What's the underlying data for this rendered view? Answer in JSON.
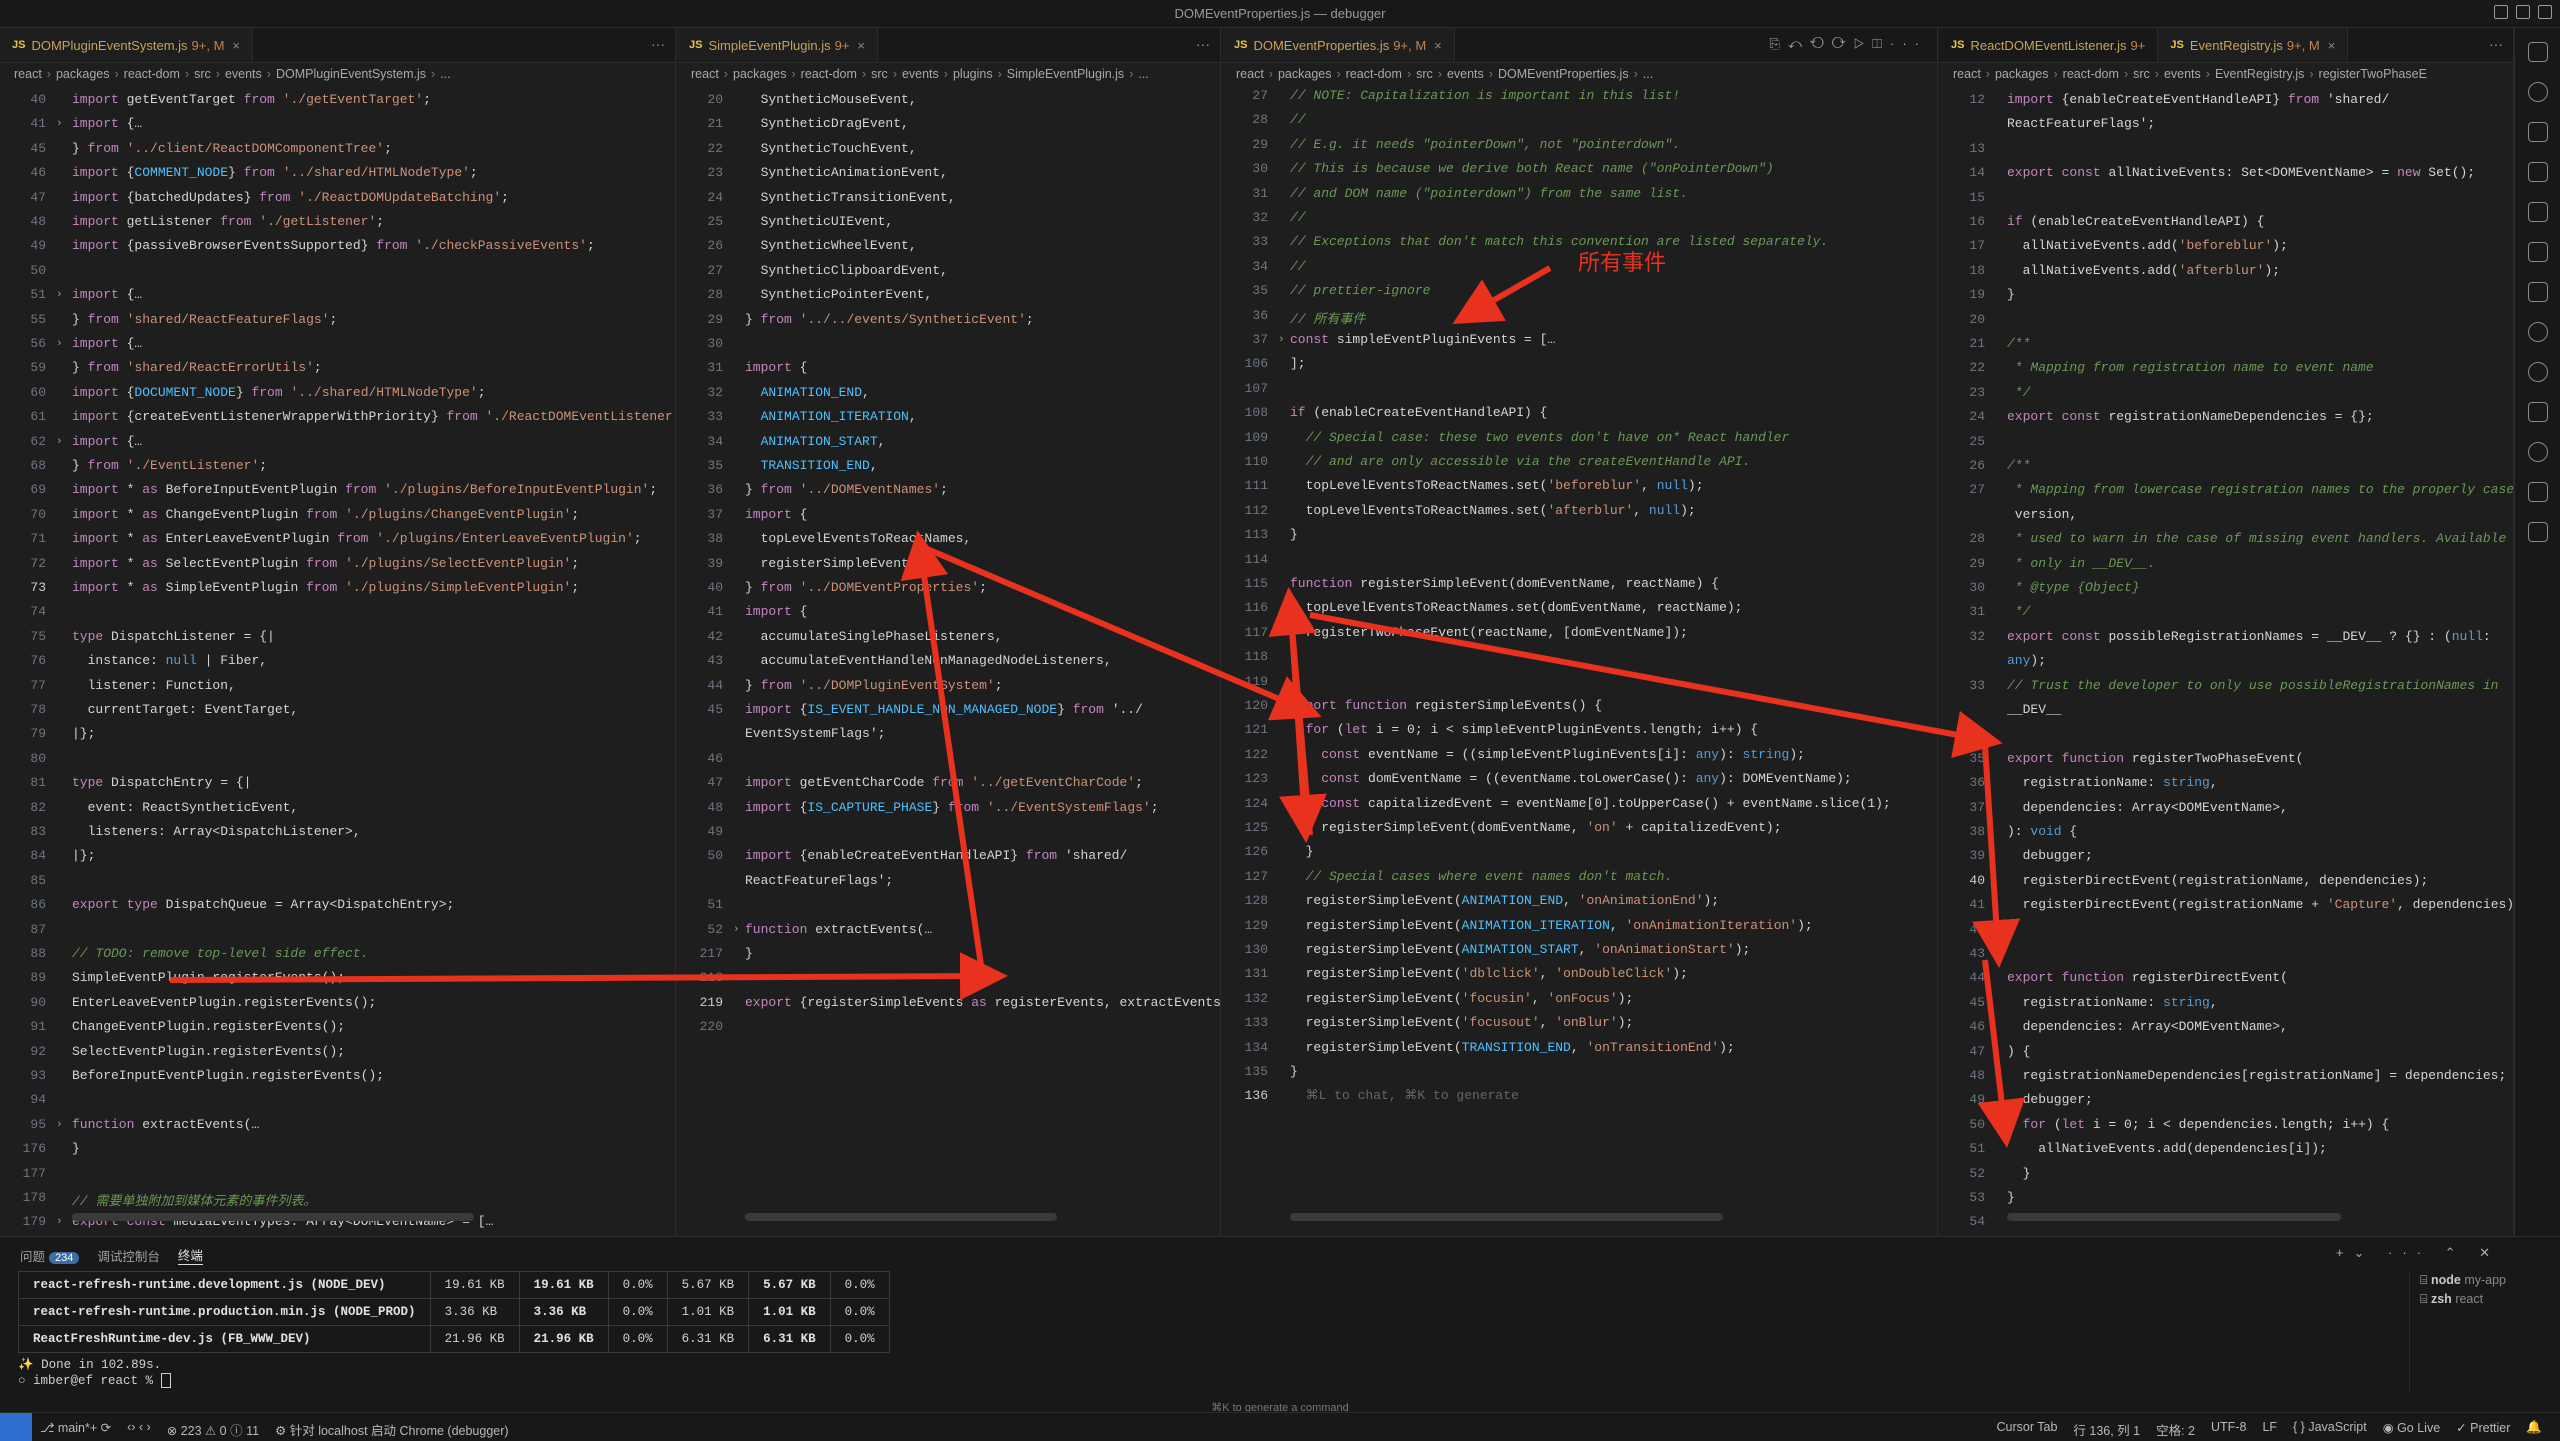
{
  "window": {
    "title": "DOMEventProperties.js — debugger"
  },
  "panes": [
    {
      "tab": {
        "name": "DOMPluginEventSystem.js",
        "modified": "9+, M"
      },
      "breadcrumb": [
        "react",
        "packages",
        "react-dom",
        "src",
        "events",
        "DOMPluginEventSystem.js",
        "..."
      ],
      "lines": [
        {
          "n": "40",
          "t": "import getEventTarget from './getEventTarget';"
        },
        {
          "n": "41",
          "t": "import {…",
          "fold": true
        },
        {
          "n": "45",
          "t": "} from '../client/ReactDOMComponentTree';"
        },
        {
          "n": "46",
          "t": "import {COMMENT_NODE} from '../shared/HTMLNodeType';"
        },
        {
          "n": "47",
          "t": "import {batchedUpdates} from './ReactDOMUpdateBatching';"
        },
        {
          "n": "48",
          "t": "import getListener from './getListener';"
        },
        {
          "n": "49",
          "t": "import {passiveBrowserEventsSupported} from './checkPassiveEvents';"
        },
        {
          "n": "50",
          "t": ""
        },
        {
          "n": "51",
          "t": "import {…",
          "fold": true
        },
        {
          "n": "55",
          "t": "} from 'shared/ReactFeatureFlags';"
        },
        {
          "n": "56",
          "t": "import {…",
          "fold": true
        },
        {
          "n": "59",
          "t": "} from 'shared/ReactErrorUtils';"
        },
        {
          "n": "60",
          "t": "import {DOCUMENT_NODE} from '../shared/HTMLNodeType';"
        },
        {
          "n": "61",
          "t": "import {createEventListenerWrapperWithPriority} from './ReactDOMEventListener';"
        },
        {
          "n": "62",
          "t": "import {…",
          "fold": true
        },
        {
          "n": "68",
          "t": "} from './EventListener';"
        },
        {
          "n": "69",
          "t": "import * as BeforeInputEventPlugin from './plugins/BeforeInputEventPlugin';"
        },
        {
          "n": "70",
          "t": "import * as ChangeEventPlugin from './plugins/ChangeEventPlugin';"
        },
        {
          "n": "71",
          "t": "import * as EnterLeaveEventPlugin from './plugins/EnterLeaveEventPlugin';"
        },
        {
          "n": "72",
          "t": "import * as SelectEventPlugin from './plugins/SelectEventPlugin';"
        },
        {
          "n": "73",
          "t": "import * as SimpleEventPlugin from './plugins/SimpleEventPlugin';",
          "cur": true
        },
        {
          "n": "74",
          "t": ""
        },
        {
          "n": "75",
          "t": "type DispatchListener = {|"
        },
        {
          "n": "76",
          "t": "  instance: null | Fiber,"
        },
        {
          "n": "77",
          "t": "  listener: Function,"
        },
        {
          "n": "78",
          "t": "  currentTarget: EventTarget,"
        },
        {
          "n": "79",
          "t": "|};"
        },
        {
          "n": "80",
          "t": ""
        },
        {
          "n": "81",
          "t": "type DispatchEntry = {|"
        },
        {
          "n": "82",
          "t": "  event: ReactSyntheticEvent,"
        },
        {
          "n": "83",
          "t": "  listeners: Array<DispatchListener>,"
        },
        {
          "n": "84",
          "t": "|};"
        },
        {
          "n": "85",
          "t": ""
        },
        {
          "n": "86",
          "t": "export type DispatchQueue = Array<DispatchEntry>;"
        },
        {
          "n": "87",
          "t": ""
        },
        {
          "n": "88",
          "t": "// TODO: remove top-level side effect."
        },
        {
          "n": "89",
          "t": "SimpleEventPlugin.registerEvents();"
        },
        {
          "n": "90",
          "t": "EnterLeaveEventPlugin.registerEvents();"
        },
        {
          "n": "91",
          "t": "ChangeEventPlugin.registerEvents();"
        },
        {
          "n": "92",
          "t": "SelectEventPlugin.registerEvents();"
        },
        {
          "n": "93",
          "t": "BeforeInputEventPlugin.registerEvents();"
        },
        {
          "n": "94",
          "t": ""
        },
        {
          "n": "95",
          "t": "function extractEvents(…",
          "fold": true
        },
        {
          "n": "176",
          "t": "}"
        },
        {
          "n": "177",
          "t": ""
        },
        {
          "n": "178",
          "t": "// 需要单独附加到媒体元素的事件列表。"
        },
        {
          "n": "179",
          "t": "export const mediaEventTypes: Array<DOMEventName> = […",
          "fold": true
        }
      ]
    },
    {
      "tab": {
        "name": "SimpleEventPlugin.js",
        "modified": "9+"
      },
      "breadcrumb": [
        "react",
        "packages",
        "react-dom",
        "src",
        "events",
        "plugins",
        "SimpleEventPlugin.js",
        "..."
      ],
      "lines": [
        {
          "n": "20",
          "t": "  SyntheticMouseEvent,"
        },
        {
          "n": "21",
          "t": "  SyntheticDragEvent,"
        },
        {
          "n": "22",
          "t": "  SyntheticTouchEvent,"
        },
        {
          "n": "23",
          "t": "  SyntheticAnimationEvent,"
        },
        {
          "n": "24",
          "t": "  SyntheticTransitionEvent,"
        },
        {
          "n": "25",
          "t": "  SyntheticUIEvent,"
        },
        {
          "n": "26",
          "t": "  SyntheticWheelEvent,"
        },
        {
          "n": "27",
          "t": "  SyntheticClipboardEvent,"
        },
        {
          "n": "28",
          "t": "  SyntheticPointerEvent,"
        },
        {
          "n": "29",
          "t": "} from '../../events/SyntheticEvent';"
        },
        {
          "n": "30",
          "t": ""
        },
        {
          "n": "31",
          "t": "import {"
        },
        {
          "n": "32",
          "t": "  ANIMATION_END,"
        },
        {
          "n": "33",
          "t": "  ANIMATION_ITERATION,"
        },
        {
          "n": "34",
          "t": "  ANIMATION_START,"
        },
        {
          "n": "35",
          "t": "  TRANSITION_END,"
        },
        {
          "n": "36",
          "t": "} from '../DOMEventNames';"
        },
        {
          "n": "37",
          "t": "import {"
        },
        {
          "n": "38",
          "t": "  topLevelEventsToReactNames,"
        },
        {
          "n": "39",
          "t": "  registerSimpleEvents,"
        },
        {
          "n": "40",
          "t": "} from '../DOMEventProperties';"
        },
        {
          "n": "41",
          "t": "import {"
        },
        {
          "n": "42",
          "t": "  accumulateSinglePhaseListeners,"
        },
        {
          "n": "43",
          "t": "  accumulateEventHandleNonManagedNodeListeners,"
        },
        {
          "n": "44",
          "t": "} from '../DOMPluginEventSystem';"
        },
        {
          "n": "45",
          "t": "import {IS_EVENT_HANDLE_NON_MANAGED_NODE} from '../"
        },
        {
          "n": "",
          "t": "EventSystemFlags';"
        },
        {
          "n": "46",
          "t": ""
        },
        {
          "n": "47",
          "t": "import getEventCharCode from '../getEventCharCode';"
        },
        {
          "n": "48",
          "t": "import {IS_CAPTURE_PHASE} from '../EventSystemFlags';"
        },
        {
          "n": "49",
          "t": ""
        },
        {
          "n": "50",
          "t": "import {enableCreateEventHandleAPI} from 'shared/"
        },
        {
          "n": "",
          "t": "ReactFeatureFlags';"
        },
        {
          "n": "51",
          "t": ""
        },
        {
          "n": "52",
          "t": "function extractEvents(…",
          "fold": true
        },
        {
          "n": "217",
          "t": "}"
        },
        {
          "n": "218",
          "t": ""
        },
        {
          "n": "219",
          "t": "export {registerSimpleEvents as registerEvents, extractEvents};",
          "cur": true
        },
        {
          "n": "220",
          "t": ""
        }
      ]
    },
    {
      "tab": {
        "name": "DOMEventProperties.js",
        "modified": "9+, M"
      },
      "breadcrumb": [
        "react",
        "packages",
        "react-dom",
        "src",
        "events",
        "DOMEventProperties.js",
        "..."
      ],
      "lines": [
        {
          "n": "27",
          "t": "// NOTE: Capitalization is important in this list!"
        },
        {
          "n": "28",
          "t": "//"
        },
        {
          "n": "29",
          "t": "// E.g. it needs \"pointerDown\", not \"pointerdown\"."
        },
        {
          "n": "30",
          "t": "// This is because we derive both React name (\"onPointerDown\")"
        },
        {
          "n": "31",
          "t": "// and DOM name (\"pointerdown\") from the same list."
        },
        {
          "n": "32",
          "t": "//"
        },
        {
          "n": "33",
          "t": "// Exceptions that don't match this convention are listed separately."
        },
        {
          "n": "34",
          "t": "//"
        },
        {
          "n": "35",
          "t": "// prettier-ignore"
        },
        {
          "n": "36",
          "t": "// 所有事件"
        },
        {
          "n": "37",
          "t": "const simpleEventPluginEvents = […",
          "fold": true
        },
        {
          "n": "106",
          "t": "];"
        },
        {
          "n": "107",
          "t": ""
        },
        {
          "n": "108",
          "t": "if (enableCreateEventHandleAPI) {"
        },
        {
          "n": "109",
          "t": "  // Special case: these two events don't have on* React handler"
        },
        {
          "n": "110",
          "t": "  // and are only accessible via the createEventHandle API."
        },
        {
          "n": "111",
          "t": "  topLevelEventsToReactNames.set('beforeblur', null);"
        },
        {
          "n": "112",
          "t": "  topLevelEventsToReactNames.set('afterblur', null);"
        },
        {
          "n": "113",
          "t": "}"
        },
        {
          "n": "114",
          "t": ""
        },
        {
          "n": "115",
          "t": "function registerSimpleEvent(domEventName, reactName) {"
        },
        {
          "n": "116",
          "t": "  topLevelEventsToReactNames.set(domEventName, reactName);"
        },
        {
          "n": "117",
          "t": "  registerTwoPhaseEvent(reactName, [domEventName]);"
        },
        {
          "n": "118",
          "t": "}"
        },
        {
          "n": "119",
          "t": ""
        },
        {
          "n": "120",
          "t": "export function registerSimpleEvents() {"
        },
        {
          "n": "121",
          "t": "  for (let i = 0; i < simpleEventPluginEvents.length; i++) {"
        },
        {
          "n": "122",
          "t": "    const eventName = ((simpleEventPluginEvents[i]: any): string);"
        },
        {
          "n": "123",
          "t": "    const domEventName = ((eventName.toLowerCase(): any): DOMEventName);"
        },
        {
          "n": "124",
          "t": "    const capitalizedEvent = eventName[0].toUpperCase() + eventName.slice(1);"
        },
        {
          "n": "125",
          "t": "    registerSimpleEvent(domEventName, 'on' + capitalizedEvent);"
        },
        {
          "n": "126",
          "t": "  }"
        },
        {
          "n": "127",
          "t": "  // Special cases where event names don't match."
        },
        {
          "n": "128",
          "t": "  registerSimpleEvent(ANIMATION_END, 'onAnimationEnd');"
        },
        {
          "n": "129",
          "t": "  registerSimpleEvent(ANIMATION_ITERATION, 'onAnimationIteration');"
        },
        {
          "n": "130",
          "t": "  registerSimpleEvent(ANIMATION_START, 'onAnimationStart');"
        },
        {
          "n": "131",
          "t": "  registerSimpleEvent('dblclick', 'onDoubleClick');"
        },
        {
          "n": "132",
          "t": "  registerSimpleEvent('focusin', 'onFocus');"
        },
        {
          "n": "133",
          "t": "  registerSimpleEvent('focusout', 'onBlur');"
        },
        {
          "n": "134",
          "t": "  registerSimpleEvent(TRANSITION_END, 'onTransitionEnd');"
        },
        {
          "n": "135",
          "t": "}"
        },
        {
          "n": "136",
          "t": "  ⌘L to chat, ⌘K to generate",
          "cur": true
        }
      ]
    },
    {
      "tabs": [
        {
          "name": "ReactDOMEventListener.js",
          "modified": "9+"
        },
        {
          "name": "EventRegistry.js",
          "modified": "9+, M"
        }
      ],
      "breadcrumb": [
        "react",
        "packages",
        "react-dom",
        "src",
        "events",
        "EventRegistry.js",
        "registerTwoPhaseE"
      ],
      "lines": [
        {
          "n": "12",
          "t": "import {enableCreateEventHandleAPI} from 'shared/"
        },
        {
          "n": "",
          "t": "ReactFeatureFlags';"
        },
        {
          "n": "13",
          "t": ""
        },
        {
          "n": "14",
          "t": "export const allNativeEvents: Set<DOMEventName> = new Set();"
        },
        {
          "n": "15",
          "t": ""
        },
        {
          "n": "16",
          "t": "if (enableCreateEventHandleAPI) {"
        },
        {
          "n": "17",
          "t": "  allNativeEvents.add('beforeblur');"
        },
        {
          "n": "18",
          "t": "  allNativeEvents.add('afterblur');"
        },
        {
          "n": "19",
          "t": "}"
        },
        {
          "n": "20",
          "t": ""
        },
        {
          "n": "21",
          "t": "/**"
        },
        {
          "n": "22",
          "t": " * Mapping from registration name to event name"
        },
        {
          "n": "23",
          "t": " */"
        },
        {
          "n": "24",
          "t": "export const registrationNameDependencies = {};"
        },
        {
          "n": "25",
          "t": ""
        },
        {
          "n": "26",
          "t": "/**"
        },
        {
          "n": "27",
          "t": " * Mapping from lowercase registration names to the properly cased"
        },
        {
          "n": "",
          "t": " version,"
        },
        {
          "n": "28",
          "t": " * used to warn in the case of missing event handlers. Available"
        },
        {
          "n": "29",
          "t": " * only in __DEV__."
        },
        {
          "n": "30",
          "t": " * @type {Object}"
        },
        {
          "n": "31",
          "t": " */"
        },
        {
          "n": "32",
          "t": "export const possibleRegistrationNames = __DEV__ ? {} : (null:"
        },
        {
          "n": "",
          "t": "any);"
        },
        {
          "n": "33",
          "t": "// Trust the developer to only use possibleRegistrationNames in"
        },
        {
          "n": "",
          "t": "__DEV__"
        },
        {
          "n": "34",
          "t": ""
        },
        {
          "n": "35",
          "t": "export function registerTwoPhaseEvent("
        },
        {
          "n": "36",
          "t": "  registrationName: string,"
        },
        {
          "n": "37",
          "t": "  dependencies: Array<DOMEventName>,"
        },
        {
          "n": "38",
          "t": "): void {"
        },
        {
          "n": "39",
          "t": "  debugger;"
        },
        {
          "n": "40",
          "t": "  registerDirectEvent(registrationName, dependencies);",
          "cur": true
        },
        {
          "n": "41",
          "t": "  registerDirectEvent(registrationName + 'Capture', dependencies);"
        },
        {
          "n": "42",
          "t": "}"
        },
        {
          "n": "43",
          "t": ""
        },
        {
          "n": "44",
          "t": "export function registerDirectEvent("
        },
        {
          "n": "45",
          "t": "  registrationName: string,"
        },
        {
          "n": "46",
          "t": "  dependencies: Array<DOMEventName>,"
        },
        {
          "n": "47",
          "t": ") {"
        },
        {
          "n": "48",
          "t": "  registrationNameDependencies[registrationName] = dependencies;"
        },
        {
          "n": "49",
          "t": "  debugger;"
        },
        {
          "n": "50",
          "t": "  for (let i = 0; i < dependencies.length; i++) {"
        },
        {
          "n": "51",
          "t": "    allNativeEvents.add(dependencies[i]);"
        },
        {
          "n": "52",
          "t": "  }"
        },
        {
          "n": "53",
          "t": "}"
        },
        {
          "n": "54",
          "t": ""
        }
      ]
    }
  ],
  "annotation": {
    "label": "所有事件",
    "color": "#e8321e"
  },
  "panel": {
    "tabs": [
      {
        "label": "问题",
        "badge": "234"
      },
      {
        "label": "调试控制台"
      },
      {
        "label": "终端"
      }
    ],
    "table": [
      [
        "react-refresh-runtime.development.js  (NODE_DEV)",
        "19.61 KB",
        "19.61 KB",
        "0.0%",
        "5.67 KB",
        "5.67 KB",
        "0.0%"
      ],
      [
        "react-refresh-runtime.production.min.js  (NODE_PROD)",
        "3.36 KB",
        "3.36 KB",
        "0.0%",
        "1.01 KB",
        "1.01 KB",
        "0.0%"
      ],
      [
        "ReactFreshRuntime-dev.js  (FB_WWW_DEV)",
        "21.96 KB",
        "21.96 KB",
        "0.0%",
        "6.31 KB",
        "6.31 KB",
        "0.0%"
      ]
    ],
    "done": "✨  Done in 102.89s.",
    "prompt": "imber@ef react % ",
    "terminals": [
      {
        "shell": "node",
        "name": "my-app"
      },
      {
        "shell": "zsh",
        "name": "react"
      }
    ],
    "hint": "⌘K to generate a command"
  },
  "status": {
    "branch": "main*+",
    "problems": "⊗ 223  ⚠ 0  ⓘ 11",
    "debug": "针对 localhost 启动 Chrome (debugger)",
    "cursor_tab": "Cursor Tab",
    "position": "行 136, 列 1",
    "spaces": "空格: 2",
    "encoding": "UTF-8",
    "eol": "LF",
    "language": "JavaScript",
    "golive": "Go Live",
    "prettier": "Prettier"
  }
}
